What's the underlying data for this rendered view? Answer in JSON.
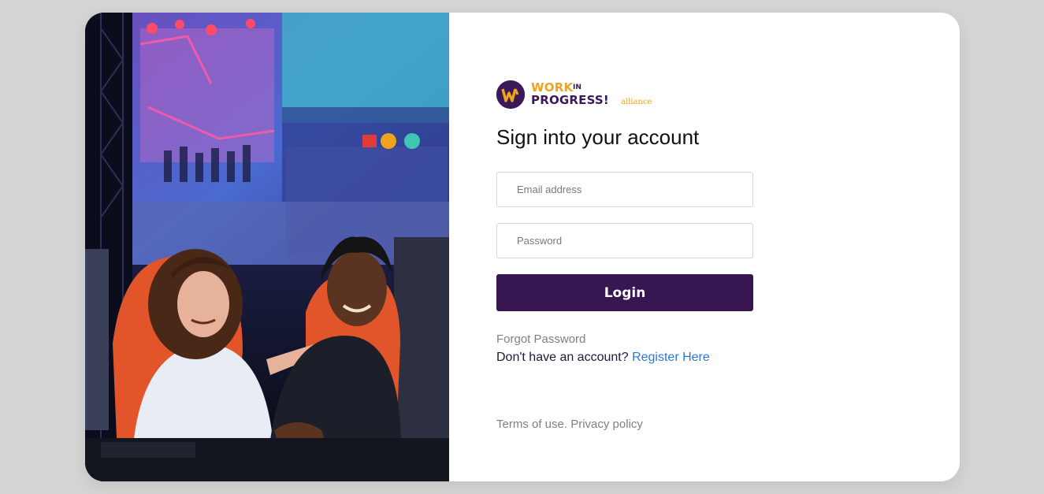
{
  "brand": {
    "logo_letter": "W",
    "logo_line1": "WORK",
    "logo_in": "IN",
    "logo_line2": "PROGRESS!",
    "logo_suffix": "alliance",
    "primary_color": "#371652",
    "accent_color": "#f0a31c"
  },
  "heading": "Sign into your account",
  "form": {
    "email_placeholder": "Email address",
    "password_placeholder": "Password",
    "login_label": "Login"
  },
  "links": {
    "forgot": "Forgot Password",
    "no_account": "Don't have an account?",
    "register": "Register Here",
    "register_color": "#2878d8",
    "terms": "Terms of use.",
    "privacy": "Privacy policy"
  },
  "hero_image": {
    "icon": "gaming-photo"
  }
}
